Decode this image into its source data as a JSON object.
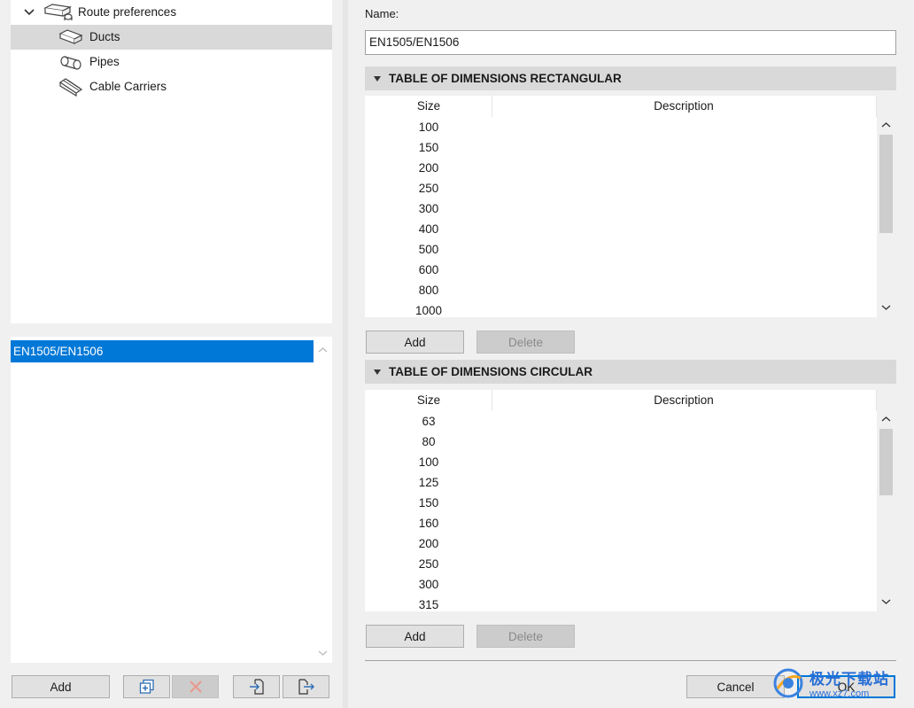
{
  "tree": {
    "root_label": "Route preferences",
    "items": [
      {
        "label": "Ducts",
        "icon": "duct-icon",
        "selected": true
      },
      {
        "label": "Pipes",
        "icon": "pipe-icon",
        "selected": false
      },
      {
        "label": "Cable Carriers",
        "icon": "cable-carrier-icon",
        "selected": false
      }
    ]
  },
  "list": {
    "items": [
      "EN1505/EN1506"
    ]
  },
  "left_toolbar": {
    "add_label": "Add",
    "icons": [
      "duplicate-icon",
      "delete-icon",
      "import-icon",
      "export-icon"
    ]
  },
  "form": {
    "name_label": "Name:",
    "name_value": "EN1505/EN1506"
  },
  "rect_table": {
    "title": "TABLE OF DIMENSIONS RECTANGULAR",
    "columns": [
      "Size",
      "Description"
    ],
    "rows": [
      "100",
      "150",
      "200",
      "250",
      "300",
      "400",
      "500",
      "600",
      "800",
      "1000"
    ],
    "add_label": "Add",
    "delete_label": "Delete"
  },
  "circ_table": {
    "title": "TABLE OF DIMENSIONS CIRCULAR",
    "columns": [
      "Size",
      "Description"
    ],
    "rows": [
      "63",
      "80",
      "100",
      "125",
      "150",
      "160",
      "200",
      "250",
      "300",
      "315"
    ],
    "add_label": "Add",
    "delete_label": "Delete"
  },
  "footer": {
    "cancel_label": "Cancel",
    "ok_label": "OK"
  },
  "watermark": {
    "cn_text": "极光下载站",
    "url": "www.xz7.com"
  },
  "colors": {
    "selection": "#0078d7",
    "tree_selected": "#d9d9d9",
    "section_header": "#d9d9d9"
  }
}
